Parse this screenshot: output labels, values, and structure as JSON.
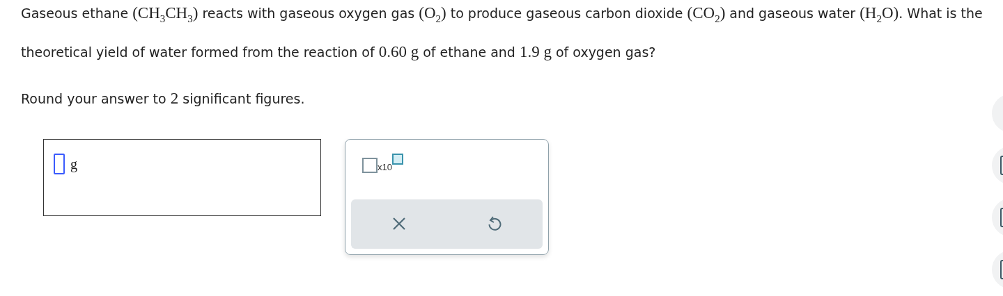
{
  "question": [
    {
      "kind": "text",
      "text": "Gaseous ethane "
    },
    {
      "kind": "math",
      "text": "(CH$_{3}$CH$_{3}$)"
    },
    {
      "kind": "text",
      "text": " reacts with gaseous oxygen gas "
    },
    {
      "kind": "math",
      "text": "(O$_{2}$)"
    },
    {
      "kind": "text",
      "text": " to produce gaseous carbon dioxide "
    },
    {
      "kind": "math",
      "text": "(CO$_{2}$)"
    },
    {
      "kind": "text",
      "text": " and gaseous water "
    },
    {
      "kind": "math",
      "text": "(H$_{2}$O)"
    },
    {
      "kind": "text",
      "text": ". What is the theoretical yield of water formed from the reaction of "
    },
    {
      "kind": "math",
      "text": "0.60 g"
    },
    {
      "kind": "text",
      "text": " of ethane and "
    },
    {
      "kind": "math",
      "text": "1.9 g"
    },
    {
      "kind": "text",
      "text": " of oxygen gas?"
    }
  ],
  "instruction": [
    {
      "kind": "text",
      "text": "Round your answer to "
    },
    {
      "kind": "math",
      "text": "2"
    },
    {
      "kind": "text",
      "text": " significant figures."
    }
  ],
  "answer": {
    "unit": "g"
  },
  "toolbox": {
    "template_label": "x10"
  }
}
